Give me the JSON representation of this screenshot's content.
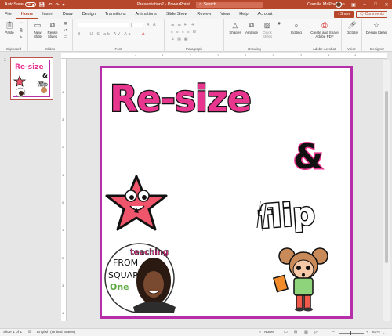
{
  "titlebar": {
    "autosave_label": "AutoSave",
    "autosave_state": "Off",
    "doc_title": "Presentation2 - PowerPoint",
    "search_placeholder": "Search",
    "user_name": "Camille McPherson"
  },
  "tabs": [
    "File",
    "Home",
    "Insert",
    "Draw",
    "Design",
    "Transitions",
    "Animations",
    "Slide Show",
    "Review",
    "View",
    "Help",
    "Acrobat"
  ],
  "active_tab": "Home",
  "share_label": "Share",
  "comments_label": "Comments",
  "ribbon": {
    "paste_label": "Paste",
    "new_slide_label": "New Slide",
    "reuse_slides_label": "Reuse Slides",
    "shapes_label": "Shapes",
    "arrange_label": "Arrange",
    "quick_styles_label": "Quick Styles",
    "editing_label": "Editing",
    "create_share_pdf_label": "Create and Share Adobe PDF",
    "dictate_label": "Dictate",
    "design_ideas_label": "Design Ideas",
    "groups": {
      "clipboard": "Clipboard",
      "slides": "Slides",
      "font": "Font",
      "paragraph": "Paragraph",
      "drawing": "Drawing",
      "adobe_acrobat": "Adobe Acrobat",
      "voice": "Voice",
      "designer": "Designer"
    }
  },
  "thumbnail": {
    "number": "1"
  },
  "slide": {
    "title_text": "Re-size",
    "ampersand": "&",
    "flip_text": "flip",
    "logo_line1": "teaching",
    "logo_line2": "FROM",
    "logo_line3": "SQUARE",
    "logo_line4": "One"
  },
  "statusbar": {
    "slide_info": "Slide 1 of 1",
    "language": "English (United States)",
    "notes_label": "Notes",
    "zoom_level": "81%"
  },
  "colors": {
    "accent": "#b7472a",
    "slide_border": "#b72fa8",
    "title_magenta": "#e8368f",
    "title_yellow": "#f2c218",
    "title_cyan": "#25c0d8",
    "star_pink": "#f0566b",
    "logo_green": "#5aa83d",
    "logo_pink": "#e8368f"
  }
}
